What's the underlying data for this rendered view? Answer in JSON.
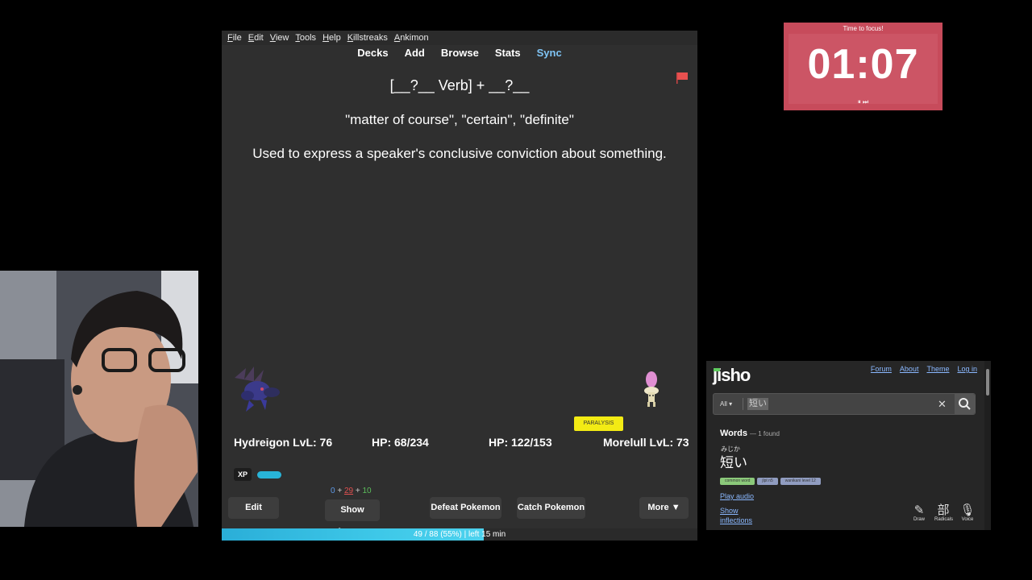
{
  "anki": {
    "menu": [
      "File",
      "Edit",
      "View",
      "Tools",
      "Help",
      "Killstreaks",
      "Ankimon"
    ],
    "toolbar": {
      "decks": "Decks",
      "add": "Add",
      "browse": "Browse",
      "stats": "Stats",
      "sync": "Sync"
    },
    "card": {
      "pattern": "[__?__ Verb] + __?__",
      "meaning": "\"matter of course\", \"certain\", \"definite\"",
      "usage": "Used to express a speaker's conclusive conviction about something."
    },
    "flag_color": "#e8504f"
  },
  "battle": {
    "player": {
      "name_level": "Hydreigon LvL: 76",
      "hp": "HP: 68/234"
    },
    "enemy": {
      "name_level": "Morelull LvL: 73",
      "hp": "HP: 122/153",
      "status": "PARALYSIS"
    },
    "xp_label": "XP",
    "counts": {
      "new": "0",
      "learn": "29",
      "review": "10",
      "plus1": "+",
      "plus2": "+"
    }
  },
  "buttons": {
    "edit": "Edit",
    "show_answer": "Show Answer",
    "defeat": "Defeat Pokemon",
    "catch": "Catch Pokemon",
    "more": "More ▼"
  },
  "progress": {
    "text": "49 / 88 (55%) | left 15 min",
    "fraction": 0.55
  },
  "timer": {
    "title": "Time to focus!",
    "time": "01:07",
    "controls": "⏸ ⏭"
  },
  "jisho": {
    "logo": "jisho",
    "nav": {
      "forum": "Forum",
      "about": "About",
      "theme": "Theme",
      "login": "Log in"
    },
    "search": {
      "filter": "All ▾",
      "query": "短い",
      "clear": "✕"
    },
    "results": {
      "heading": "Words",
      "count": "— 1 found"
    },
    "entry": {
      "furigana": "みじか",
      "word": "短い",
      "tags": [
        "common word",
        "jlpt n5",
        "wanikani level 12"
      ],
      "play_audio": "Play audio",
      "show_inflections_1": "Show",
      "show_inflections_2": "inflections"
    },
    "tools": [
      {
        "glyph": "✎",
        "label": "Draw"
      },
      {
        "glyph": "部",
        "label": "Radicals"
      },
      {
        "glyph": "🎙",
        "label": "Voice"
      }
    ]
  }
}
